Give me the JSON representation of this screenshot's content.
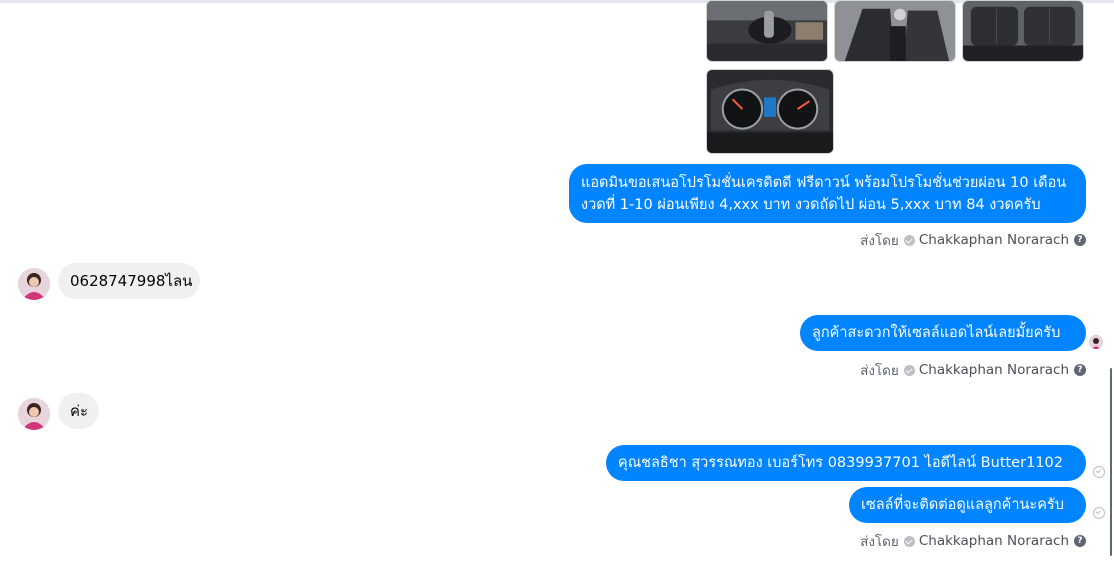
{
  "chat": {
    "photos": [
      {
        "alt": "car-gear-shifter-photo"
      },
      {
        "alt": "car-front-seats-photo"
      },
      {
        "alt": "car-rear-seats-photo"
      },
      {
        "alt": "car-dashboard-gauges-photo"
      }
    ],
    "messages": {
      "promo_line1": "แอดมินขอเสนอโปรโมชั่นเครดิตดี ฟรีดาวน์ พร้อมโปรโมชั่นช่วยผ่อน 10 เดือน",
      "promo_line2": "งวดที่ 1-10 ผ่อนเพียง 4,xxx บาท งวดถัดไป ผ่อน 5,xxx บาท 84 งวดครับ",
      "customer_phone": "0628747998ไลน",
      "ask_line": "ลูกค้าสะดวกให้เซลล์แอดไลน์เลยมั้ยครับ",
      "customer_ok": "ค่ะ",
      "sales_contact": "คุณชลธิชา สุวรรณทอง   เบอร์โทร 0839937701  ไอดีไลน์ Butter1102",
      "sales_note": "เซลล์ที่จะติดต่อดูแลลูกค้านะครับ"
    },
    "sent_by_label": "ส่งโดย",
    "sender_name": "Chakkaphan Norarach",
    "help_glyph": "?",
    "colors": {
      "outgoing_bubble": "#0084ff",
      "incoming_bubble": "#f0f0f0"
    }
  }
}
